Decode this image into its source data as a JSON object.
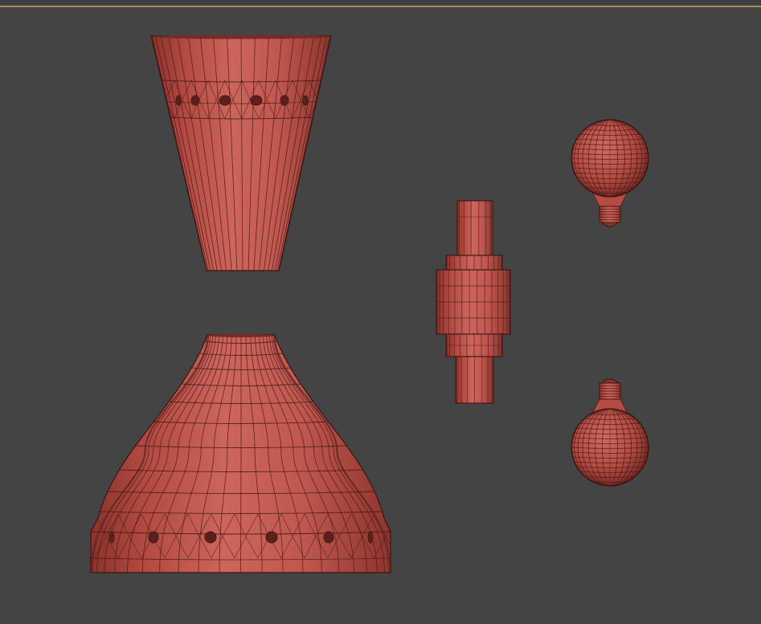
{
  "viewport": {
    "background": "#444444",
    "frame_color": "#a38f5e",
    "mesh_color": "#c2584f",
    "wire_color": "#4a1a17",
    "display_mode": "edged-faces"
  },
  "objects": [
    {
      "name": "upper-lamp-shade",
      "shape": "truncated-cone"
    },
    {
      "name": "lower-lamp-shade",
      "shape": "bell"
    },
    {
      "name": "connector-cylinder",
      "shape": "stepped-cylinder"
    },
    {
      "name": "light-bulb-upper",
      "shape": "bulb"
    },
    {
      "name": "light-bulb-lower",
      "shape": "bulb"
    }
  ]
}
